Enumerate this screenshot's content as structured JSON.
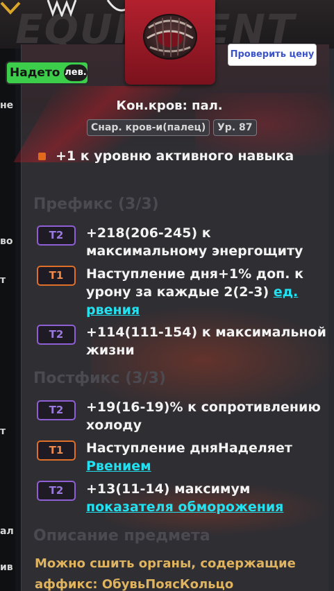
{
  "background": {
    "title_word": "EQUIPMENT",
    "left_labels": [
      "не",
      "во",
      "т",
      "т",
      "ал",
      "ив"
    ]
  },
  "item": {
    "name": "Кон.кров: пал.",
    "type_tag": "Снар. кров-и(палец)",
    "level_tag": "Ур. 87",
    "icon": "ring-icon"
  },
  "equipped": {
    "label": "Надето",
    "side": "лев."
  },
  "price_button": "Проверить цену",
  "implicit": "+1 к уровню активного навыка",
  "prefix_header": "Префикс (3/3)",
  "prefixes": [
    {
      "tier": "T2",
      "line1": "+218(206-245) к",
      "line2": "максимальному энергощиту"
    },
    {
      "tier": "T1",
      "line1": "Наступление дня+1% доп. к",
      "line2a": "урону за каждые 2(2-3) ",
      "link_a": "ед.",
      "link_b": "рвения"
    },
    {
      "tier": "T2",
      "line1": "+114(111-154) к максимальной",
      "line2": "жизни"
    }
  ],
  "suffix_header": "Постфикс (3/3)",
  "suffixes": [
    {
      "tier": "T2",
      "line1": "+19(16-19)% к сопротивлению",
      "line2": "холоду"
    },
    {
      "tier": "T1",
      "line1": "Наступление дняНаделяет",
      "link": "Рвением"
    },
    {
      "tier": "T2",
      "line1": "+13(11-14) максимум",
      "link": "показателя обморожения"
    }
  ],
  "description_header": "Описание предмета",
  "description": [
    "Можно сшить органы, содержащие",
    "аффикс: ОбувьПоясКольцо"
  ],
  "colors": {
    "tier2": "#8f5fd6",
    "tier1": "#e06f2a",
    "link": "#22e1f0",
    "description": "#e0b45e",
    "equipped_bg": "#3ccd4a",
    "icon_bg": "#b3202e"
  }
}
